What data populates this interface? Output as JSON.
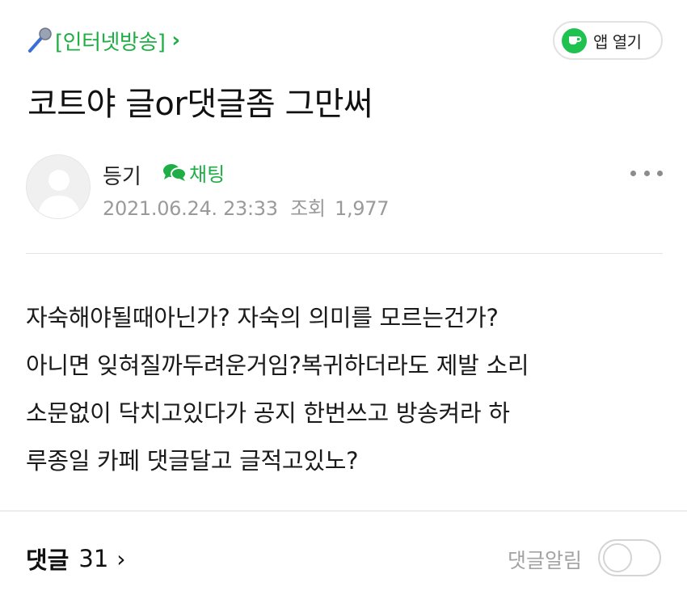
{
  "category": {
    "label": "[인터넷방송]",
    "chevron": "›"
  },
  "app_button": {
    "label": "앱 열기"
  },
  "post": {
    "title": "코트야 글or댓글좀 그만써",
    "author": "등기",
    "chat_label": "채팅",
    "date": "2021.06.24. 23:33",
    "views_label": "조회",
    "views": "1,977",
    "body_lines": [
      "자숙해야될때아닌가? 자숙의 의미를 모르는건가?",
      "아니면 잊혀질까두려운거임?복귀하더라도 제발 소리",
      "소문없이 닥치고있다가 공지 한번쓰고 방송켜라 하",
      "루종일 카페 댓글달고 글적고있노?"
    ]
  },
  "comments": {
    "label": "댓글",
    "count": "31",
    "chevron": "›",
    "notify_label": "댓글알림",
    "notify_on": false
  },
  "icons": {
    "category": "microphone-icon",
    "app": "coffee-cup-icon",
    "chat": "chat-bubbles-icon",
    "more": "more-dots-icon",
    "avatar": "default-avatar-icon"
  },
  "colors": {
    "accent_green": "#1fae45",
    "app_badge_green": "#1fc24f",
    "meta_gray": "#9a9a9a"
  }
}
